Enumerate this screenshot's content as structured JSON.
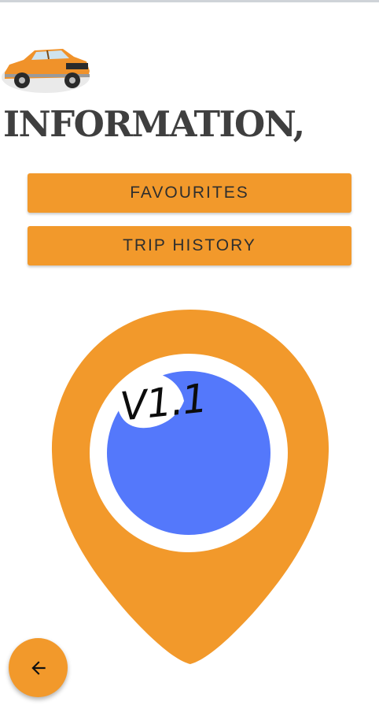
{
  "header": {
    "title": "INFORMATION,",
    "logo_icon": "vintage-car-icon"
  },
  "menu": {
    "favourites_label": "FAVOURITES",
    "trip_history_label": "TRIP HISTORY"
  },
  "hero": {
    "icon": "map-pin-icon",
    "version_label": "V1.1"
  },
  "navigation": {
    "back_icon": "arrow-left-icon"
  },
  "colors": {
    "accent": "#f2992b",
    "pin_center": "#5478fb",
    "title_text": "#3f3f3f"
  }
}
